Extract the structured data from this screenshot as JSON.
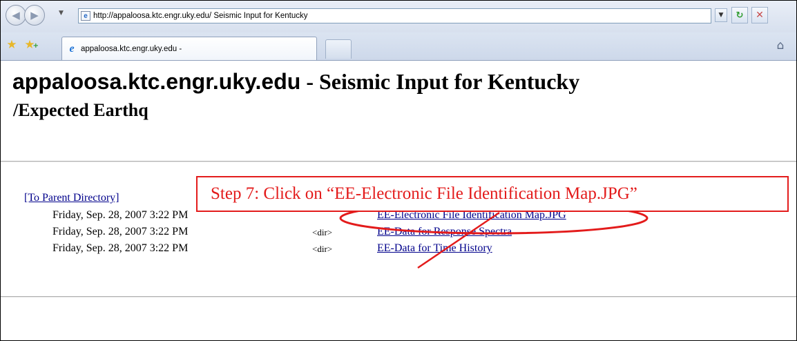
{
  "browser": {
    "address_url": "http://appaloosa.ktc.engr.uky.edu/ Seismic Input for Kentucky",
    "tab_label": "appaloosa.ktc.engr.uky.edu -",
    "icons": [
      "back-icon",
      "forward-icon",
      "refresh-icon",
      "stop-icon",
      "favorites-star-icon",
      "add-favorite-icon",
      "home-icon"
    ]
  },
  "page": {
    "title_host": "appaloosa.ktc.engr.uky.edu",
    "title_sep": " - ",
    "title_rest": "Seismic Input for Kentucky",
    "subtitle": "/Expected Earthq",
    "parent_link": "[To Parent Directory]",
    "rows": [
      {
        "date": "Friday, Sep. 28, 2007 3:22 PM",
        "dir": "",
        "name": "EE-Electronic File Identification Map.JPG"
      },
      {
        "date": "Friday, Sep. 28, 2007 3:22 PM",
        "dir": "<dir>",
        "name": "EE-Data for Response Spectra"
      },
      {
        "date": "Friday, Sep. 28, 2007 3:22 PM",
        "dir": "<dir>",
        "name": "EE-Data for Time History"
      }
    ]
  },
  "annotation": {
    "callout_text": "Step 7: Click on “EE-Electronic File Identification Map.JPG”",
    "color": "#e31b1b"
  }
}
